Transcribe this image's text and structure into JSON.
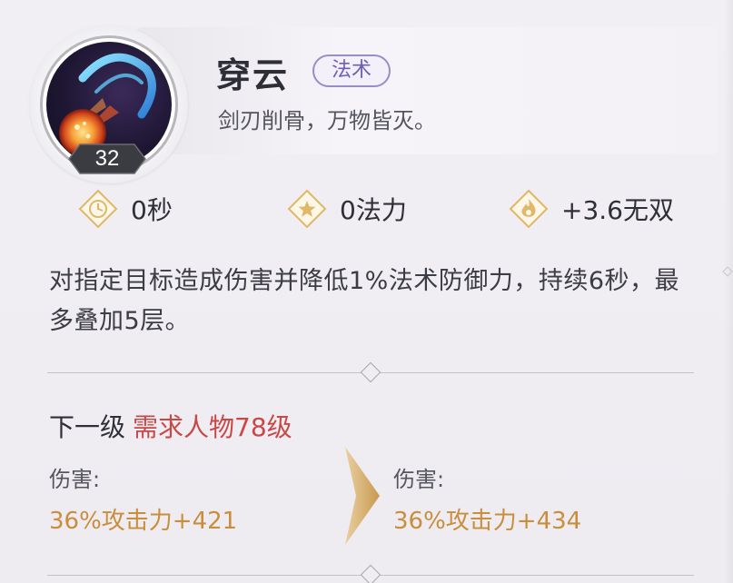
{
  "skill": {
    "name": "穿云",
    "type_tag": "法术",
    "motto": "剑刃削骨，万物皆灭。",
    "level": "32",
    "icon": "meteor-skill-icon"
  },
  "stats": {
    "cooldown": "0秒",
    "mana_cost": "0法力",
    "wushuang": "+3.6无双"
  },
  "description": "对指定目标造成伤害并降低1%法术防御力，持续6秒，最多叠加5层。",
  "next_level": {
    "label": "下一级",
    "requirement": "需求人物78级"
  },
  "damage": {
    "current_label": "伤害:",
    "current_value": "36%攻击力+421",
    "next_label": "伤害:",
    "next_value": "36%攻击力+434"
  },
  "colors": {
    "requirement": "#c84848",
    "damage_value": "#c98d3c",
    "tag": "#6e5fb3",
    "stat_icon": "#e0b867"
  }
}
